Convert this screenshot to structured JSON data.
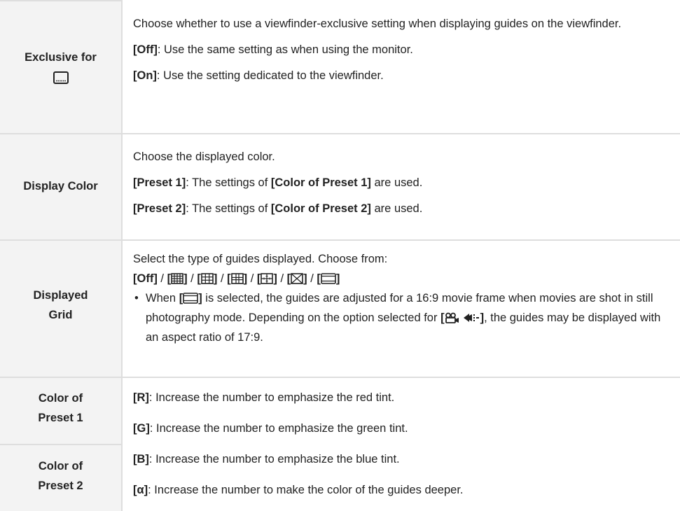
{
  "rows": {
    "exclusive": {
      "label_line1": "Exclusive for",
      "viewfinder_icon": "viewfinder-icon",
      "desc": "Choose whether to use a viewfinder-exclusive setting when displaying guides on the viewfinder.",
      "off_key": "[Off]",
      "off_text": ": Use the same setting as when using the monitor.",
      "on_key": "[On]",
      "on_text": ": Use the setting dedicated to the viewfinder."
    },
    "display_color": {
      "label": "Display Color",
      "desc": "Choose the displayed color.",
      "p1_key": "[Preset 1]",
      "p1_mid": ": The settings of ",
      "p1_ref": "[Color of Preset 1]",
      "p1_end": " are used.",
      "p2_key": "[Preset 2]",
      "p2_mid": ": The settings of ",
      "p2_ref": "[Color of Preset 2]",
      "p2_end": " are used."
    },
    "displayed_grid": {
      "label_line1": "Displayed",
      "label_line2": "Grid",
      "desc": "Select the type of guides displayed. Choose from:",
      "off_key": "[Off]",
      "separator": " / ",
      "bracket_open": "[",
      "bracket_close": "]",
      "grid_icons": [
        "grid-4x4-icon",
        "grid-3x3-icon",
        "grid-golden-icon",
        "grid-scale-icon",
        "grid-diagonal-icon",
        "grid-16-9-icon"
      ],
      "bullet_pre": "When ",
      "bullet_key_close": "]",
      "bullet_text": " is selected, the guides are adjusted for a 16:9 movie frame when movies are shot in still photography mode. Depending on the option selected for ",
      "movie_key": "[",
      "movie_key_close": "]",
      "bullet_end": ", the guides may be displayed with an aspect ratio of 17:9."
    },
    "color_presets": {
      "preset1_line1": "Color of",
      "preset1_line2": "Preset 1",
      "preset2_line1": "Color of",
      "preset2_line2": "Preset 2",
      "r_key": "[R]",
      "r_text": ": Increase the number to emphasize the red tint.",
      "g_key": "[G]",
      "g_text": ": Increase the number to emphasize the green tint.",
      "b_key": "[B]",
      "b_text": ": Increase the number to emphasize the blue tint.",
      "a_key": "[α]",
      "a_text": ": Increase the number to make the color of the guides deeper."
    }
  },
  "colors": {
    "label_bg": "#f3f3f3",
    "border": "#dedede",
    "text": "#222222"
  }
}
